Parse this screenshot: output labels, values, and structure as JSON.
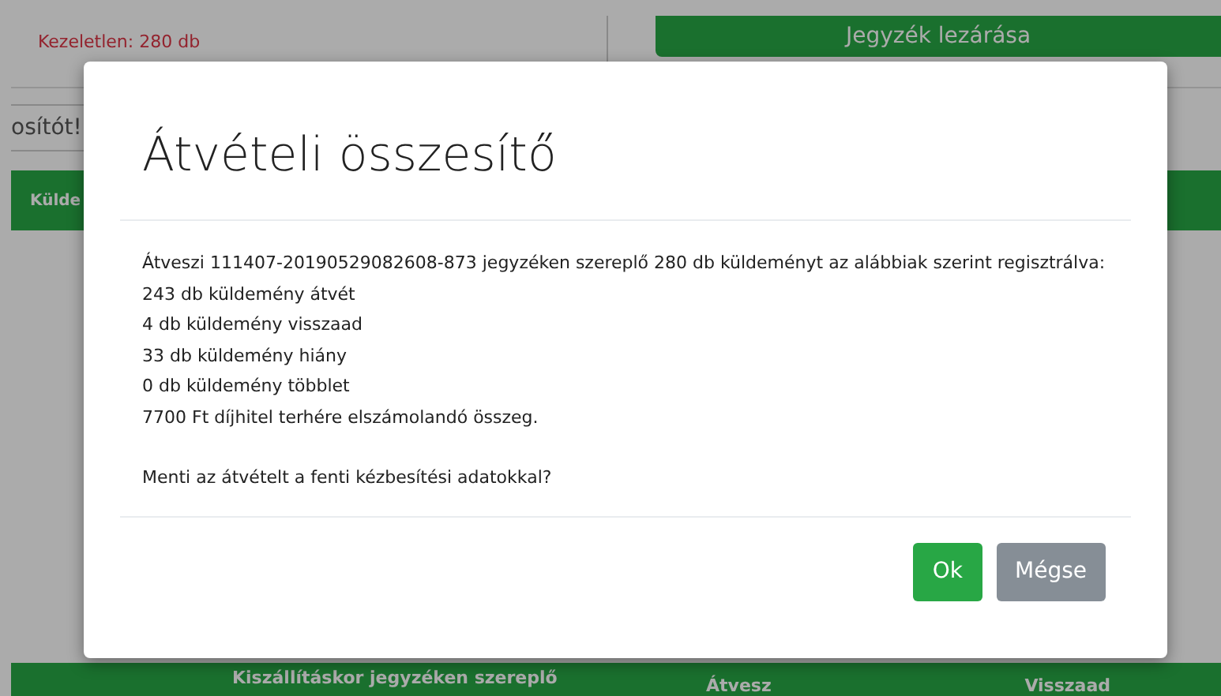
{
  "background": {
    "unhandled_count": "Kezeletlen: 280 db",
    "close_list_button": "Jegyzék lezárása",
    "search": {
      "placeholder": "osítót!"
    },
    "table_header": "Külde",
    "bottom_table": {
      "columns": [
        "Kiszállításkor jegyzéken szereplő",
        "Átvesz",
        "Visszaad"
      ]
    }
  },
  "modal": {
    "title": "Átvételi összesítő",
    "summary_lines": [
      "Átveszi 111407-20190529082608-873 jegyzéken szereplő 280 db küldeményt az alábbiak szerint regisztrálva:",
      "243 db küldemény átvét",
      "4 db küldemény visszaad",
      "33 db küldemény hiány",
      "0 db küldemény többlet",
      "7700 Ft díjhitel terhére elszámolandó összeg."
    ],
    "question": "Menti az átvételt a fenti kézbesítési adatokkal?",
    "buttons": [
      {
        "label": "Ok",
        "kind": "primary"
      },
      {
        "label": "Mégse",
        "kind": "secondary"
      }
    ]
  }
}
